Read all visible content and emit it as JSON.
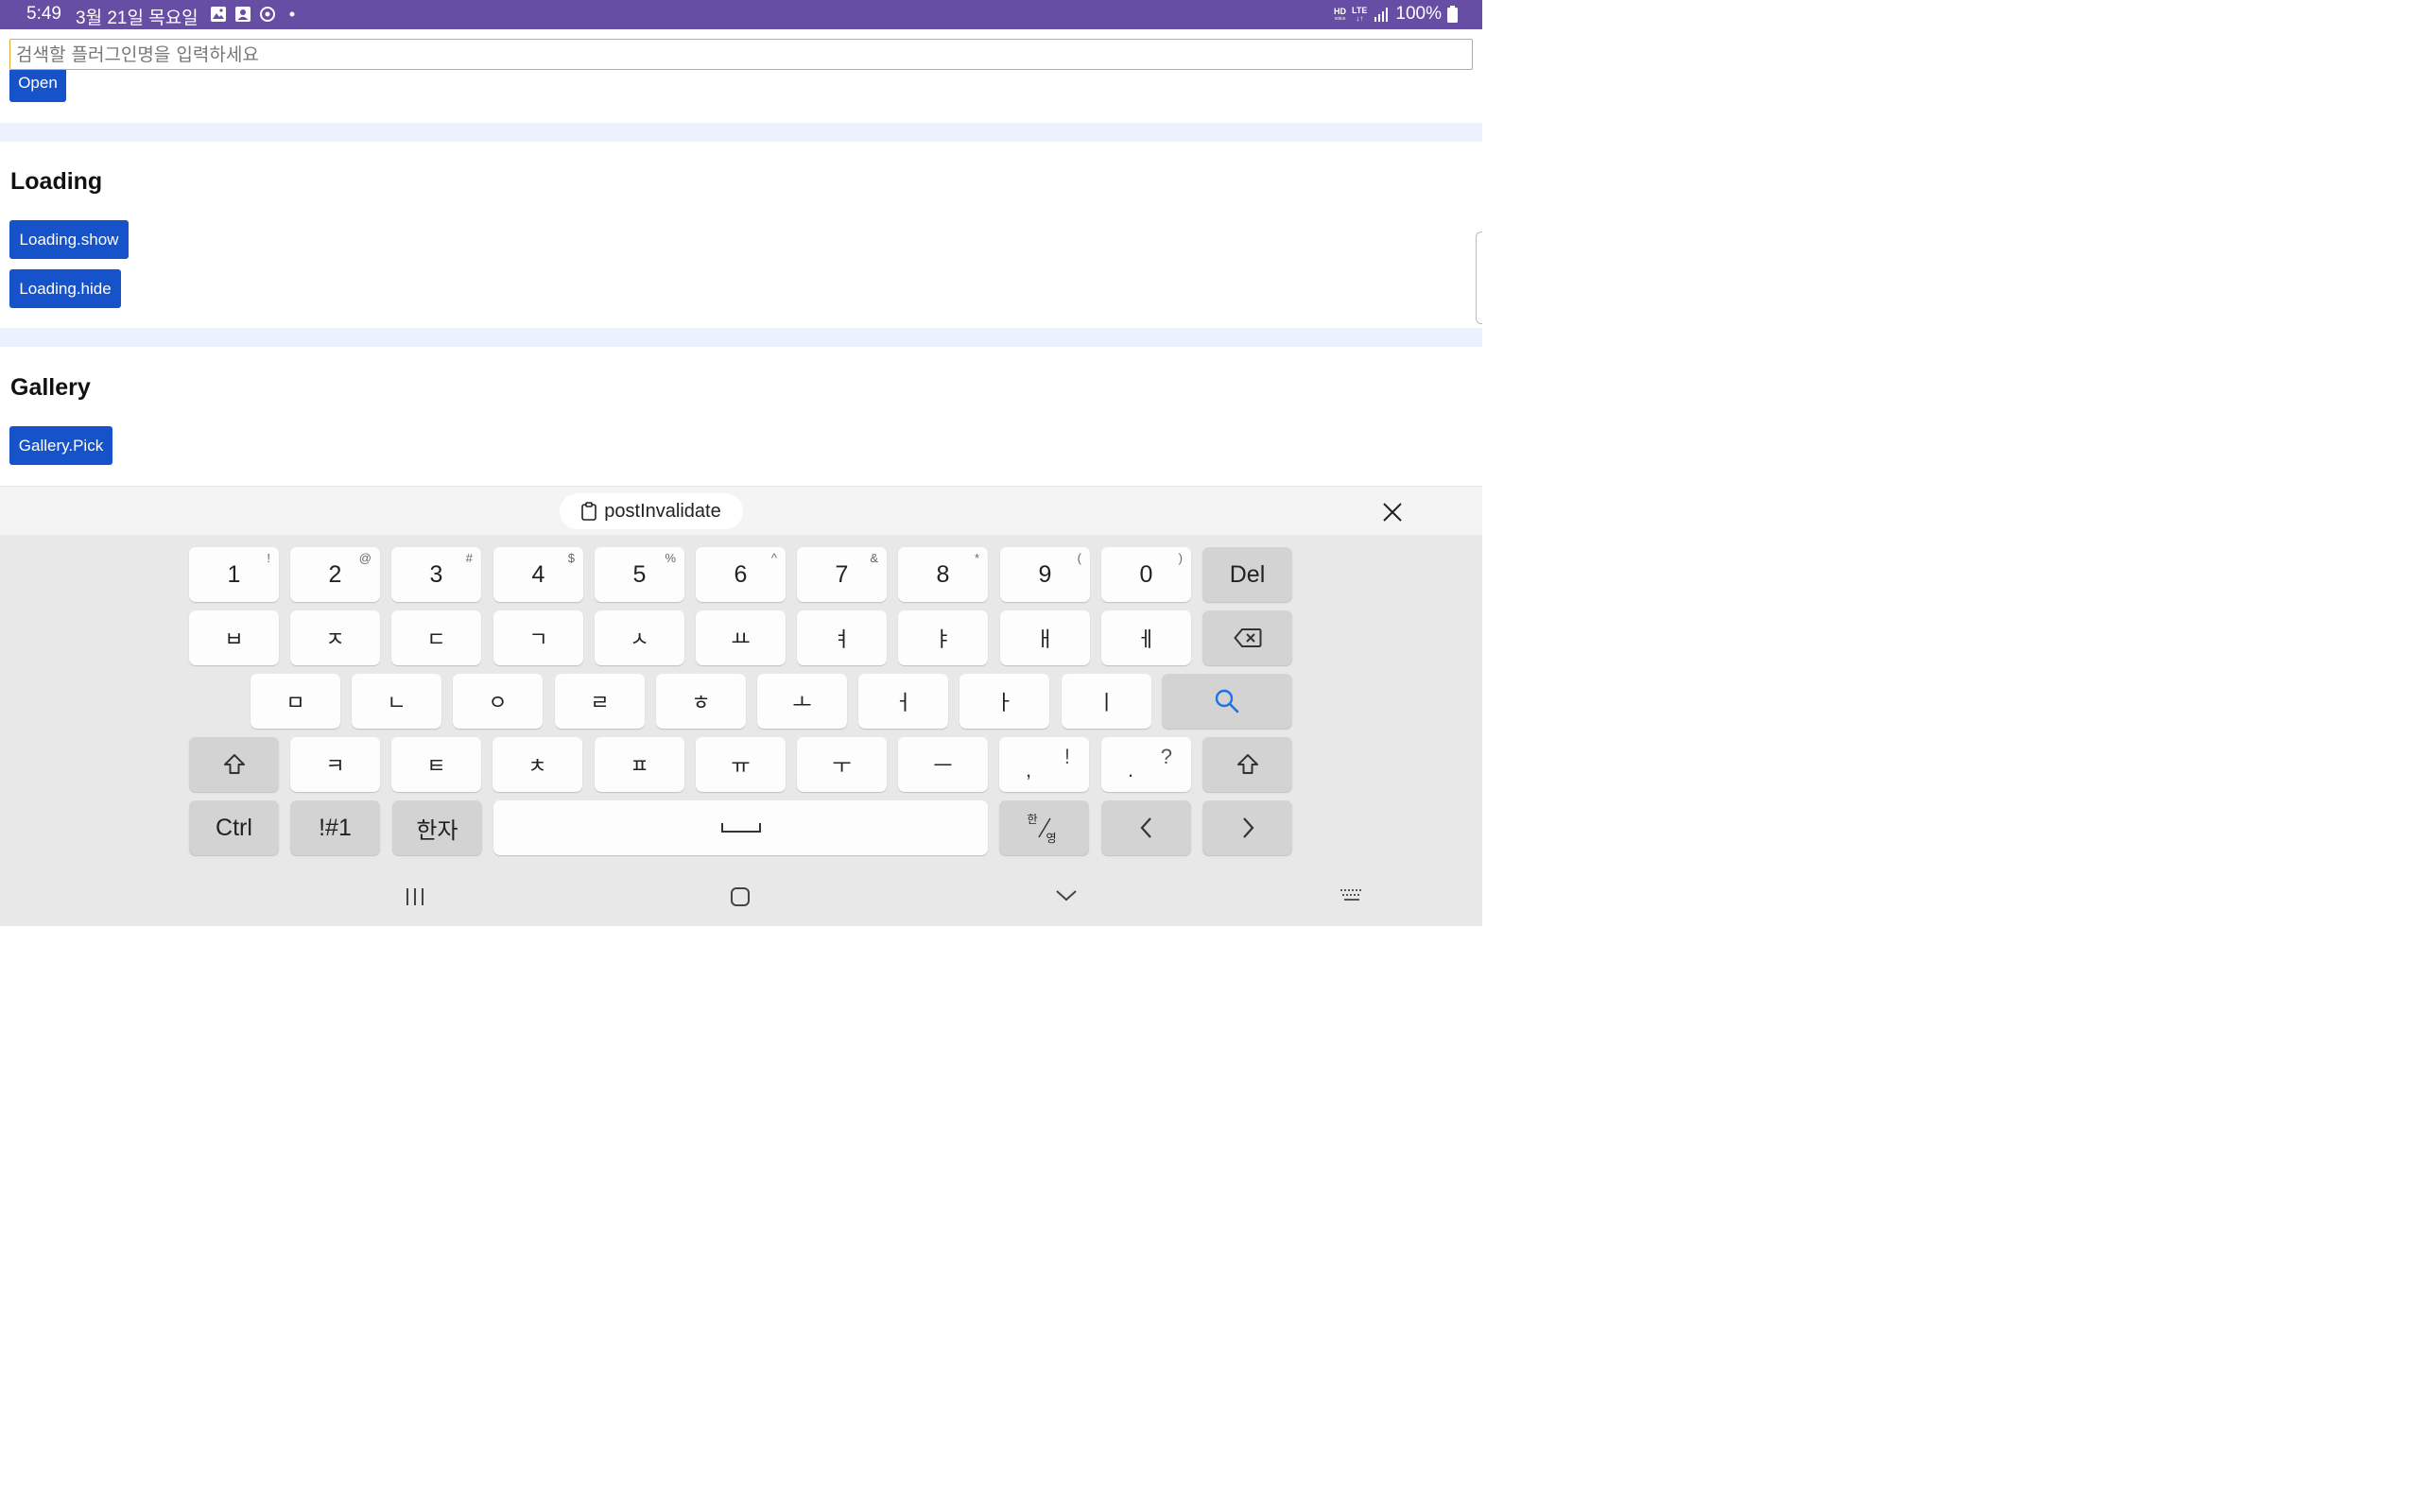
{
  "status_bar": {
    "time": "5:49",
    "date": "3월 21일 목요일",
    "battery": "100%",
    "hd_label": "HD",
    "voice_label": "voice",
    "lte_label": "LTE",
    "bar_color": "#654ea3"
  },
  "search": {
    "placeholder": "검색할 플러그인명을 입력하세요",
    "value": ""
  },
  "content": {
    "open_button": "Open",
    "loading_title": "Loading",
    "loading_show_button": "Loading.show",
    "loading_hide_button": "Loading.hide",
    "gallery_title": "Gallery",
    "gallery_pick_button": "Gallery.Pick",
    "button_color": "#1652c9",
    "band_color": "#ebf2fd"
  },
  "keyboard": {
    "suggestion_chip": "postInvalidate",
    "row1": [
      {
        "label": "1",
        "sup": "!"
      },
      {
        "label": "2",
        "sup": "@"
      },
      {
        "label": "3",
        "sup": "#"
      },
      {
        "label": "4",
        "sup": "$"
      },
      {
        "label": "5",
        "sup": "%"
      },
      {
        "label": "6",
        "sup": "^"
      },
      {
        "label": "7",
        "sup": "&"
      },
      {
        "label": "8",
        "sup": "*"
      },
      {
        "label": "9",
        "sup": "("
      },
      {
        "label": "0",
        "sup": ")"
      }
    ],
    "del_label": "Del",
    "row2": [
      "ㅂ",
      "ㅈ",
      "ㄷ",
      "ㄱ",
      "ㅅ",
      "ㅛ",
      "ㅕ",
      "ㅑ",
      "ㅐ",
      "ㅔ"
    ],
    "row3": [
      "ㅁ",
      "ㄴ",
      "ㅇ",
      "ㄹ",
      "ㅎ",
      "ㅗ",
      "ㅓ",
      "ㅏ",
      "ㅣ"
    ],
    "row4": [
      "ㅋ",
      "ㅌ",
      "ㅊ",
      "ㅍ",
      "ㅠ",
      "ㅜ",
      "ㅡ"
    ],
    "comma_key": {
      "main": ",",
      "sup": "!"
    },
    "period_key": {
      "main": ".",
      "sup": "?"
    },
    "ctrl_label": "Ctrl",
    "sym_label": "!#1",
    "hanja_label": "한자",
    "lang_top": "한",
    "lang_bottom": "영",
    "left_label": "<",
    "right_label": ">",
    "accent_color": "#1a73e8"
  }
}
